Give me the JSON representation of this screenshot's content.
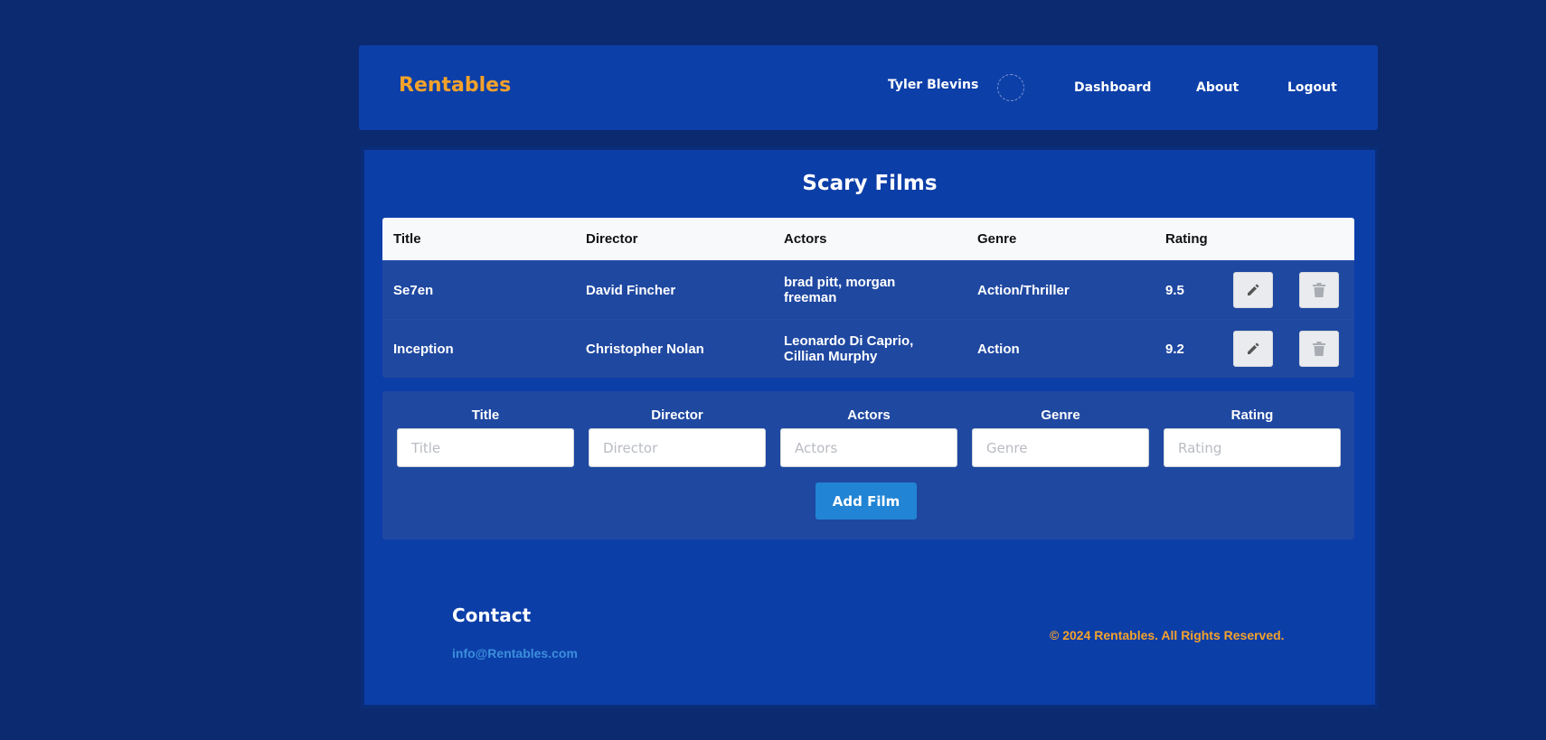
{
  "nav": {
    "brand": "Rentables",
    "user_name": "Tyler Blevins",
    "links": [
      "Dashboard",
      "About",
      "Logout"
    ]
  },
  "page": {
    "title": "Scary Films"
  },
  "table": {
    "headers": [
      "Title",
      "Director",
      "Actors",
      "Genre",
      "Rating"
    ],
    "rows": [
      {
        "title": "Se7en",
        "director": "David Fincher",
        "actors": "brad pitt, morgan freeman",
        "genre": "Action/Thriller",
        "rating": "9.5"
      },
      {
        "title": "Inception",
        "director": "Christopher Nolan",
        "actors": "Leonardo Di Caprio, Cillian Murphy",
        "genre": "Action",
        "rating": "9.2"
      }
    ],
    "row_actions": {
      "edit_icon": "pencil-icon",
      "delete_icon": "trash-icon"
    }
  },
  "form": {
    "fields": [
      {
        "label": "Title",
        "placeholder": "Title",
        "value": ""
      },
      {
        "label": "Director",
        "placeholder": "Director",
        "value": ""
      },
      {
        "label": "Actors",
        "placeholder": "Actors",
        "value": ""
      },
      {
        "label": "Genre",
        "placeholder": "Genre",
        "value": ""
      },
      {
        "label": "Rating",
        "placeholder": "Rating",
        "value": ""
      }
    ],
    "submit_label": "Add Film"
  },
  "footer": {
    "contact_title": "Contact",
    "email": "info@Rentables.com",
    "copyright": "© 2024 Rentables. All Rights Reserved."
  },
  "colors": {
    "background": "#0b2a6f",
    "panel": "#0c3ea8",
    "accent_orange": "#f4a22b",
    "button_blue": "#2184d4"
  }
}
